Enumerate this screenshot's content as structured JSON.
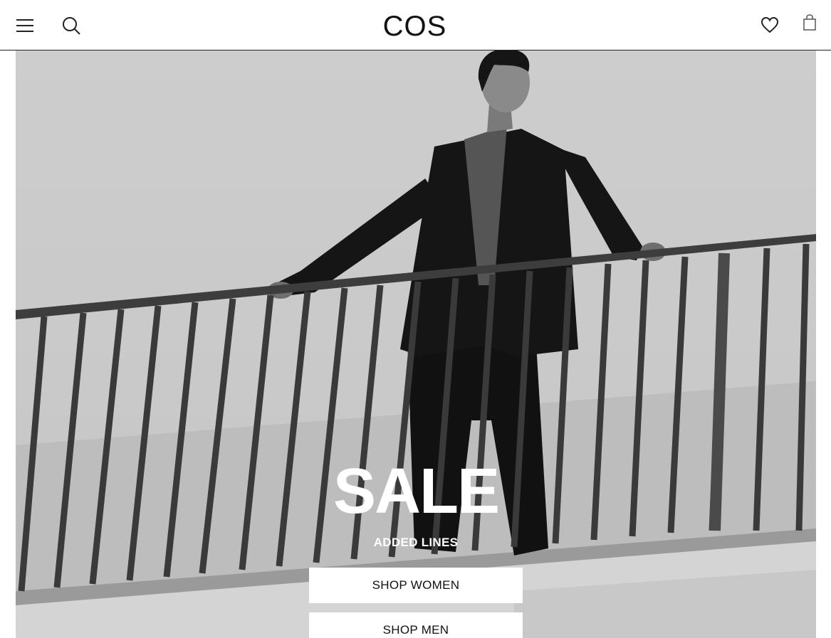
{
  "header": {
    "logo": "COS",
    "menu_icon": "hamburger-menu-icon",
    "search_icon": "search-icon",
    "wishlist_icon": "heart-icon",
    "bag_icon": "shopping-bag-icon"
  },
  "hero": {
    "title": "SALE",
    "subtitle": "ADDED LINES",
    "buttons": [
      {
        "label": "SHOP WOMEN"
      },
      {
        "label": "SHOP MEN"
      }
    ]
  },
  "colors": {
    "text": "#111111",
    "background": "#ffffff",
    "hero_overlay_text": "#ffffff"
  }
}
